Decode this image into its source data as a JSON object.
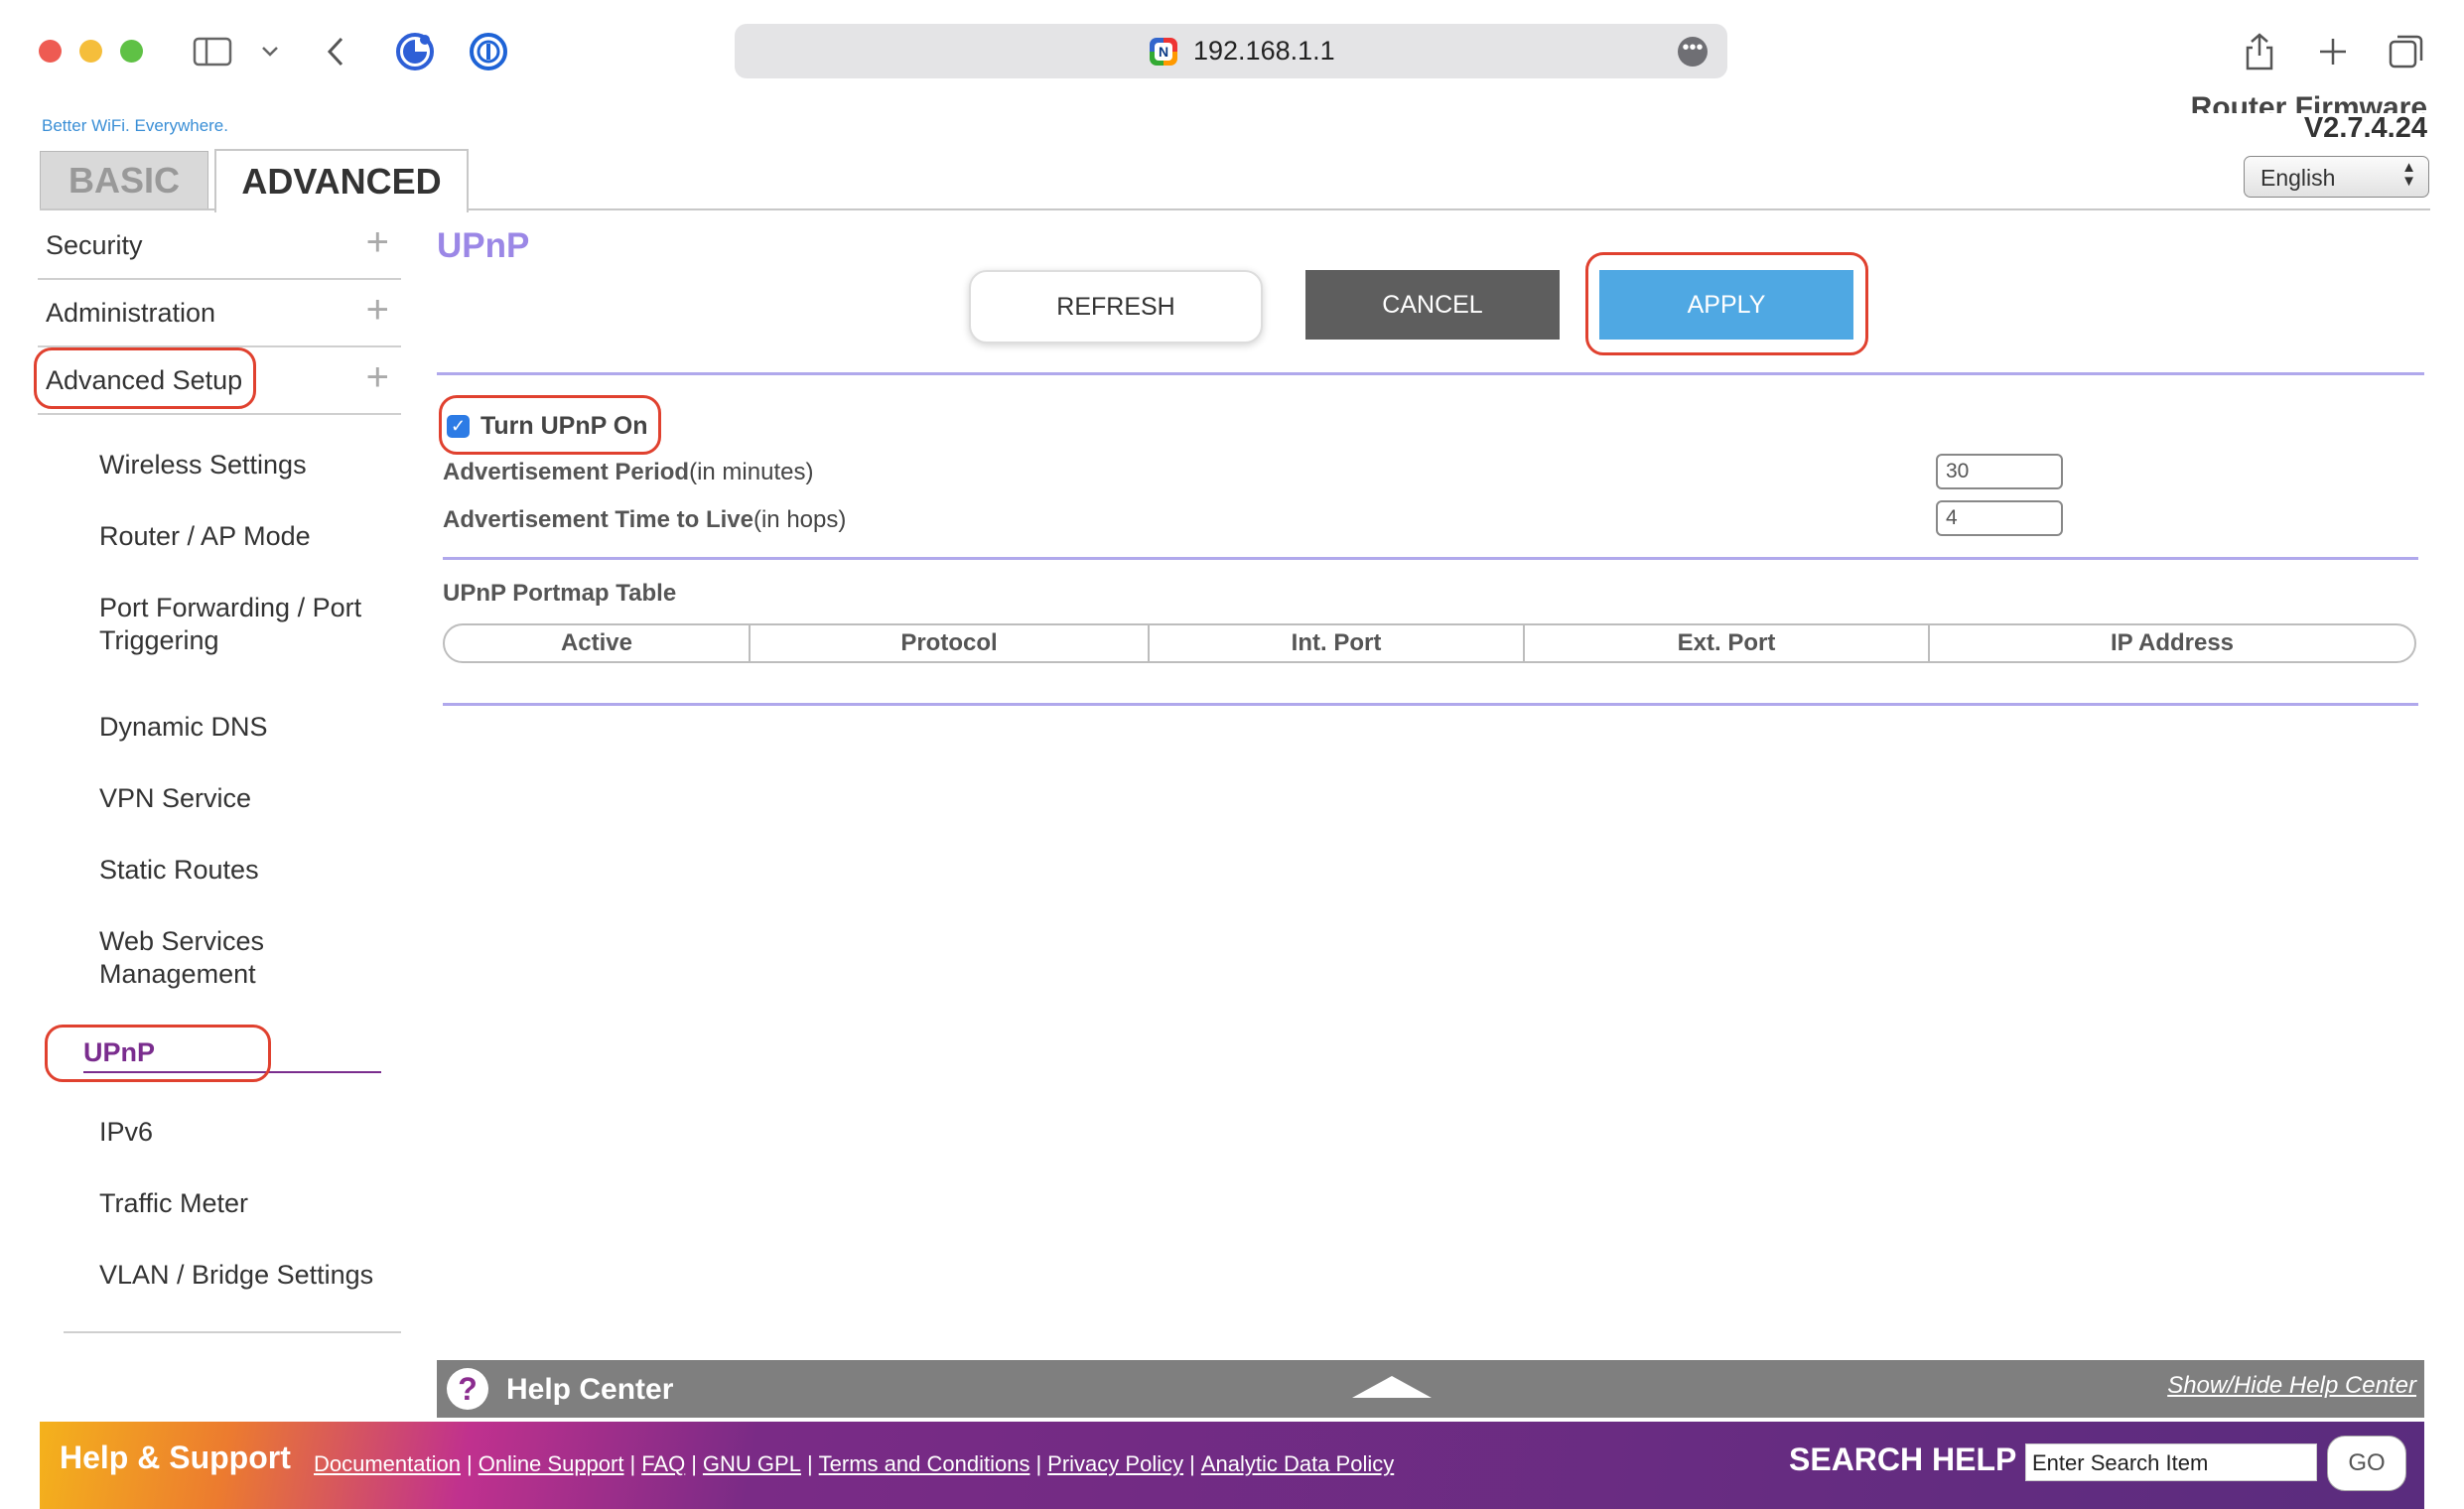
{
  "browser": {
    "url": "192.168.1.1",
    "site_icon_letter": "N",
    "more_glyph": "•••"
  },
  "header": {
    "tagline": "Better WiFi. Everywhere.",
    "firmware_label": "Router Firmware Version",
    "firmware_version": "V2.7.4.24",
    "language": "English"
  },
  "tabs": {
    "basic": "BASIC",
    "advanced": "ADVANCED"
  },
  "sidebar": {
    "sections": [
      {
        "label": "Security"
      },
      {
        "label": "Administration"
      },
      {
        "label": "Advanced Setup"
      }
    ],
    "plus_glyph": "+",
    "items": [
      {
        "label": "Wireless Settings"
      },
      {
        "label": "Router / AP Mode"
      },
      {
        "label": "Port Forwarding / Port Triggering"
      },
      {
        "label": "Dynamic DNS"
      },
      {
        "label": "VPN Service"
      },
      {
        "label": "Static Routes"
      },
      {
        "label": "Web Services Management"
      },
      {
        "label": "UPnP"
      },
      {
        "label": "IPv6"
      },
      {
        "label": "Traffic Meter"
      },
      {
        "label": "VLAN / Bridge Settings"
      }
    ]
  },
  "content": {
    "title": "UPnP",
    "buttons": {
      "refresh": "REFRESH",
      "cancel": "CANCEL",
      "apply": "APPLY"
    },
    "upnp_toggle": {
      "label": "Turn UPnP On",
      "checked": true,
      "check_glyph": "✓"
    },
    "adv_period": {
      "label_bold": "Advertisement Period",
      "label_unit": "(in minutes)",
      "value": "30"
    },
    "adv_ttl": {
      "label_bold": "Advertisement Time to Live",
      "label_unit": "(in hops)",
      "value": "4"
    },
    "portmap": {
      "title": "UPnP Portmap Table",
      "columns": [
        "Active",
        "Protocol",
        "Int. Port",
        "Ext. Port",
        "IP Address"
      ]
    }
  },
  "help": {
    "icon_glyph": "?",
    "title": "Help Center",
    "toggle": "Show/Hide Help Center"
  },
  "footer": {
    "title": "Help & Support",
    "links": [
      "Documentation",
      "Online Support",
      "FAQ",
      "GNU GPL",
      "Terms and Conditions",
      "Privacy Policy",
      "Analytic Data Policy"
    ],
    "separator": "|",
    "search_title": "SEARCH HELP",
    "search_placeholder": "Enter Search Item",
    "go": "GO"
  },
  "colors": {
    "accent_blue": "#4fa8e3",
    "title_purple": "#9b87e6",
    "active_purple": "#7a2d8e",
    "highlight_red": "#e0412f"
  }
}
